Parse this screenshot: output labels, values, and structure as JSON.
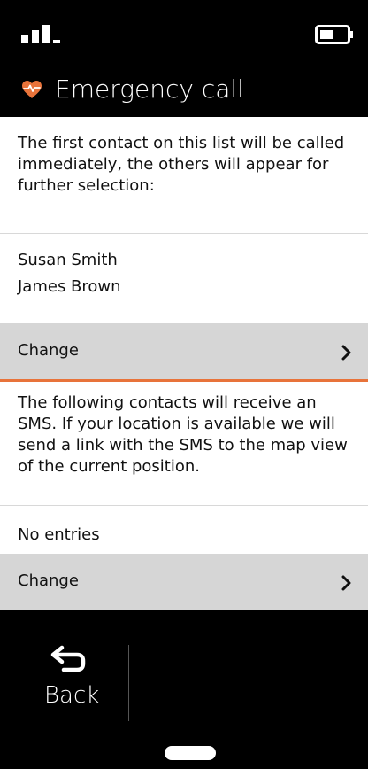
{
  "status_bar": {
    "signal_icon": "signal-strength-icon",
    "battery_icon": "battery-icon"
  },
  "header": {
    "icon": "heart-pulse-icon",
    "icon_color": "#e8733a",
    "title": "Emergency call"
  },
  "call_section": {
    "description": "The first contact on this list will be called immediately, the others will appear for further selection:",
    "contacts": [
      "Susan Smith",
      "James Brown"
    ],
    "change_label": "Change"
  },
  "sms_section": {
    "description": "The following contacts will receive an SMS. If your location is available we will send a link with the SMS to the map view of the current position.",
    "empty_label": "No entries",
    "change_label": "Change"
  },
  "bottom_bar": {
    "back_label": "Back",
    "back_icon": "back-arrow-icon"
  },
  "colors": {
    "accent": "#e8733a",
    "row_background": "#d6d6d6"
  }
}
